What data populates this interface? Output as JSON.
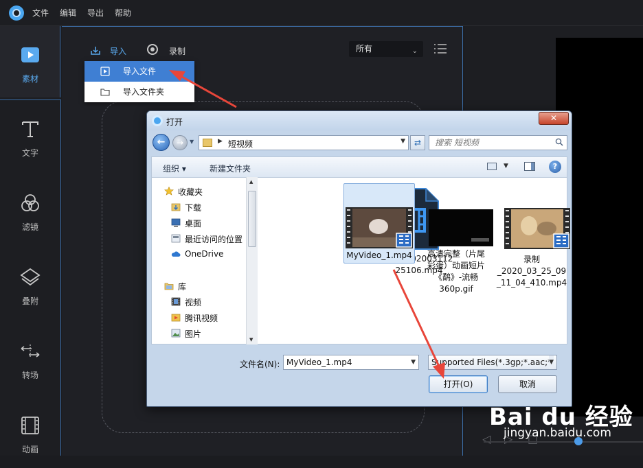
{
  "menubar": {
    "items": [
      "文件",
      "编辑",
      "导出",
      "帮助"
    ]
  },
  "leftnav": {
    "items": [
      {
        "label": "素材",
        "icon": "media-icon"
      },
      {
        "label": "文字",
        "icon": "text-icon"
      },
      {
        "label": "滤镜",
        "icon": "filter-icon"
      },
      {
        "label": "叠附",
        "icon": "overlay-icon"
      },
      {
        "label": "转场",
        "icon": "transition-icon"
      },
      {
        "label": "动画",
        "icon": "animation-icon"
      }
    ]
  },
  "panel": {
    "import_label": "导入",
    "record_label": "录制",
    "filter_value": "所有",
    "import_menu": [
      "导入文件",
      "导入文件夹"
    ]
  },
  "dialog": {
    "title": "打开",
    "close_glyph": "✕",
    "address": "短视频",
    "search_placeholder": "搜索 短视频",
    "toolbar": {
      "organize": "组织 ▾",
      "new_folder": "新建文件夹"
    },
    "nav_items": [
      {
        "label": "收藏夹",
        "icon": "star-icon"
      },
      {
        "label": "下载",
        "icon": "download-folder-icon"
      },
      {
        "label": "桌面",
        "icon": "desktop-icon"
      },
      {
        "label": "最近访问的位置",
        "icon": "recent-places-icon"
      },
      {
        "label": "OneDrive",
        "icon": "cloud-icon"
      },
      {
        "label": "库",
        "icon": "library-icon"
      },
      {
        "label": "视频",
        "icon": "video-library-icon"
      },
      {
        "label": "腾讯视频",
        "icon": "tencent-video-icon"
      },
      {
        "label": "图片",
        "icon": "pictures-icon"
      }
    ],
    "files": [
      {
        "name_lines": [
          "lv_0_202003112",
          "25106.mp4"
        ]
      },
      {
        "name_lines": [
          "MyVideo_1.mp4"
        ]
      },
      {
        "name_lines": [
          "高清完整（片尾",
          "彩蛋）动画短片",
          "《鹬》-流畅",
          "360p.gif"
        ]
      },
      {
        "name_lines": [
          "录制",
          "_2020_03_25_09",
          "_11_04_410.mp4"
        ]
      }
    ],
    "filename_label": "文件名(N):",
    "filename_value": "MyVideo_1.mp4",
    "filetype_value": "Supported Files(*.3gp;*.aac;*",
    "open_label": "打开(O)",
    "cancel_label": "取消"
  },
  "watermark": {
    "logo": "Bai du 经验",
    "url": "jingyan.baidu.com"
  },
  "colors": {
    "accent": "#3f7fd3",
    "nav_active": "#5aaaf0",
    "arrow": "#e8463a"
  }
}
